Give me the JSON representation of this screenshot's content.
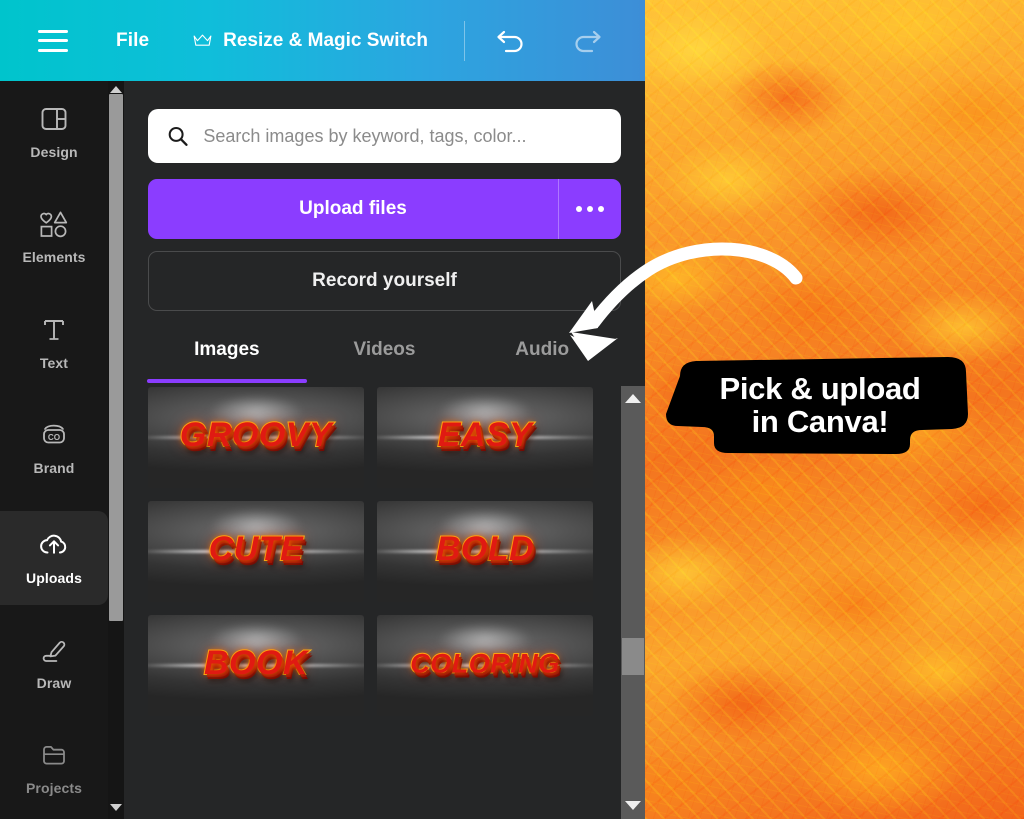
{
  "topbar": {
    "menu_icon": "hamburger-icon",
    "file_label": "File",
    "resize_label": "Resize & Magic Switch",
    "crown_icon": "crown-icon",
    "undo_icon": "undo-icon",
    "redo_icon": "redo-icon",
    "gradient_from": "#00C4CC",
    "gradient_to": "#3D8ED7"
  },
  "rail": {
    "items": [
      {
        "label": "Design",
        "icon": "design-icon",
        "active": false
      },
      {
        "label": "Elements",
        "icon": "elements-icon",
        "active": false
      },
      {
        "label": "Text",
        "icon": "text-icon",
        "active": false
      },
      {
        "label": "Brand",
        "icon": "brand-icon",
        "active": false
      },
      {
        "label": "Uploads",
        "icon": "cloud-upload-icon",
        "active": true
      },
      {
        "label": "Draw",
        "icon": "pen-icon",
        "active": false
      },
      {
        "label": "Projects",
        "icon": "folder-icon",
        "active": false
      }
    ],
    "active_bg": "#2a2a2a"
  },
  "panel": {
    "search": {
      "placeholder": "Search images by keyword, tags, color...",
      "value": "",
      "icon": "search-icon"
    },
    "upload_button": {
      "label": "Upload files",
      "color": "#8B3DFF",
      "more_icon": "ellipsis-icon"
    },
    "record_button": {
      "label": "Record yourself"
    },
    "tabs": [
      {
        "label": "Images",
        "active": true
      },
      {
        "label": "Videos",
        "active": false
      },
      {
        "label": "Audio",
        "active": false
      }
    ],
    "tab_accent": "#8B3DFF",
    "thumbnails": [
      {
        "text": "GROOVY",
        "size": "normal"
      },
      {
        "text": "EASY",
        "size": "normal"
      },
      {
        "text": "CUTE",
        "size": "normal"
      },
      {
        "text": "BOLD",
        "size": "normal"
      },
      {
        "text": "BOOK",
        "size": "normal"
      },
      {
        "text": "COLORING",
        "size": "small"
      }
    ],
    "thumbnail_text_color": "#E01A12",
    "thumbnail_stroke_color": "#FFC21A"
  },
  "annotation": {
    "arrow_icon": "curved-arrow-icon",
    "arrow_color": "#FFFFFF",
    "callout_line1": "Pick & upload",
    "callout_line2": "in Canva!",
    "callout_bg": "#000000",
    "callout_text_color": "#FFFFFF"
  },
  "canvas": {
    "background_name": "lava-texture",
    "base_color": "#F9942B"
  }
}
